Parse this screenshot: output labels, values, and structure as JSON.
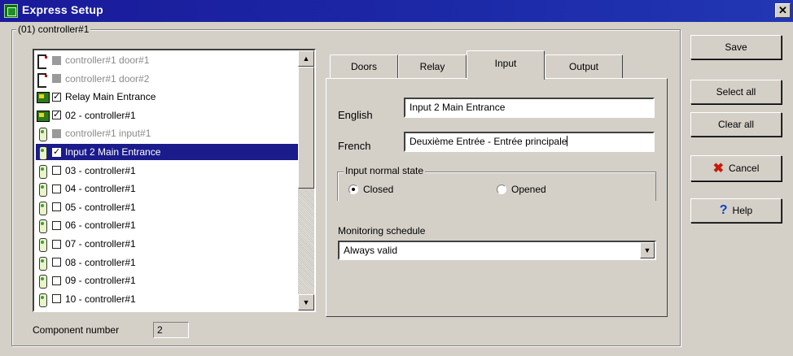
{
  "window": {
    "title": "Express Setup",
    "close_glyph": "✕"
  },
  "group": {
    "label": "(01) controller#1"
  },
  "list": {
    "items": [
      {
        "label": "controller#1 door#1",
        "icon": "door-icon",
        "check": "gray",
        "disabled": true
      },
      {
        "label": "controller#1 door#2",
        "icon": "door-icon",
        "check": "gray",
        "disabled": true
      },
      {
        "label": "Relay Main Entrance",
        "icon": "relay-icon",
        "check": "checked",
        "disabled": false
      },
      {
        "label": "02 - controller#1",
        "icon": "relay-icon",
        "check": "checked",
        "disabled": false
      },
      {
        "label": "controller#1 input#1",
        "icon": "input-icon",
        "check": "gray",
        "disabled": true
      },
      {
        "label": "Input 2 Main Entrance",
        "icon": "input-icon",
        "check": "checked",
        "disabled": false,
        "selected": true
      },
      {
        "label": "03 - controller#1",
        "icon": "input-icon",
        "check": "empty",
        "disabled": false
      },
      {
        "label": "04 - controller#1",
        "icon": "input-icon",
        "check": "empty",
        "disabled": false
      },
      {
        "label": "05 - controller#1",
        "icon": "input-icon",
        "check": "empty",
        "disabled": false
      },
      {
        "label": "06 - controller#1",
        "icon": "input-icon",
        "check": "empty",
        "disabled": false
      },
      {
        "label": "07 - controller#1",
        "icon": "input-icon",
        "check": "empty",
        "disabled": false
      },
      {
        "label": "08 - controller#1",
        "icon": "input-icon",
        "check": "empty",
        "disabled": false
      },
      {
        "label": "09 - controller#1",
        "icon": "input-icon",
        "check": "empty",
        "disabled": false
      },
      {
        "label": "10 - controller#1",
        "icon": "input-icon",
        "check": "empty",
        "disabled": false
      }
    ]
  },
  "component": {
    "label": "Component number",
    "value": "2"
  },
  "tabs": [
    {
      "label": "Doors"
    },
    {
      "label": "Relay"
    },
    {
      "label": "Input",
      "active": true
    },
    {
      "label": "Output"
    }
  ],
  "input_tab": {
    "english_label": "English",
    "english_value": "Input 2 Main Entrance",
    "french_label": "French",
    "french_value": "Deuxième Entrée - Entrée principale",
    "normal_state_label": "Input normal state",
    "closed_label": "Closed",
    "opened_label": "Opened",
    "selected_state": "Closed",
    "schedule_label": "Monitoring schedule",
    "schedule_value": "Always valid"
  },
  "buttons": {
    "save": "Save",
    "select_all": "Select all",
    "clear_all": "Clear all",
    "cancel": "Cancel",
    "help": "Help"
  },
  "colors": {
    "title_bar": "#1a1a9a",
    "selection": "#1b1b8c",
    "face": "#d4d0c8"
  }
}
